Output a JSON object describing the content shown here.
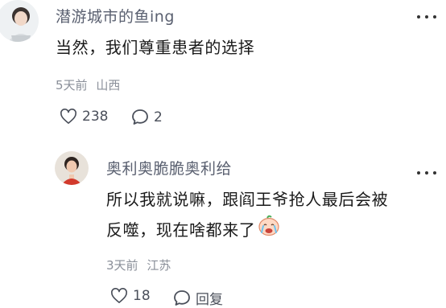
{
  "comment": {
    "username": "潜游城市的鱼ing",
    "text": "当然，我们尊重患者的选择",
    "time": "5天前",
    "location": "山西",
    "likes": "238",
    "replies": "2",
    "more_icon": "more-horizontal-icon",
    "like_icon": "heart-outline-icon",
    "reply_icon": "speech-bubble-icon"
  },
  "reply": {
    "username": "奥利奥脆脆奥利给",
    "text_line1": "所以我就说嘛，跟阎王爷抢人最后会被",
    "text_line2": "反噬，现在啥都来了",
    "emoji_icon": "crying-face-emoji",
    "time": "3天前",
    "location": "江苏",
    "likes": "18",
    "reply_label": "回复",
    "more_icon": "more-horizontal-icon",
    "like_icon": "heart-outline-icon",
    "reply_icon": "speech-bubble-icon"
  },
  "colors": {
    "username": "#5a6070",
    "text": "#1a1a1a",
    "meta": "#8a8f99"
  }
}
